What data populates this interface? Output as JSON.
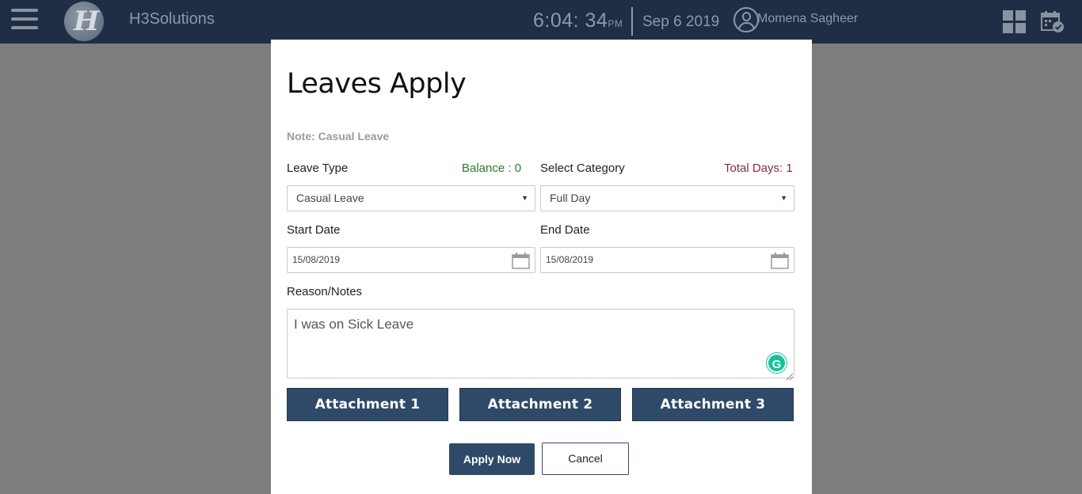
{
  "header": {
    "brand": "H3Solutions",
    "logo_letter": "H",
    "time": "6:04: 34",
    "ampm": "PM",
    "date": "Sep 6 2019",
    "username": "Momena Sagheer"
  },
  "modal": {
    "title": "Leaves Apply",
    "note": "Note: Casual Leave",
    "leave_type_label": "Leave Type",
    "balance_text": "Balance : 0",
    "leave_type_value": "Casual Leave",
    "category_label": "Select Category",
    "total_days_text": "Total Days: 1",
    "category_value": "Full Day",
    "start_date_label": "Start Date",
    "start_date_value": "15/08/2019",
    "end_date_label": "End Date",
    "end_date_value": "15/08/2019",
    "reason_label": "Reason/Notes",
    "reason_value": "I was on Sick Leave",
    "grammarly_letter": "G",
    "attachments": [
      "Attachment 1",
      "Attachment 2",
      "Attachment 3"
    ],
    "apply_label": "Apply Now",
    "cancel_label": "Cancel"
  },
  "colors": {
    "header_bg": "#1f2d45",
    "overlay_bg": "#7d7d7d",
    "primary_button": "#2f4a68",
    "balance_green": "#2b7a2b",
    "total_days_red": "#8b2c3a"
  }
}
